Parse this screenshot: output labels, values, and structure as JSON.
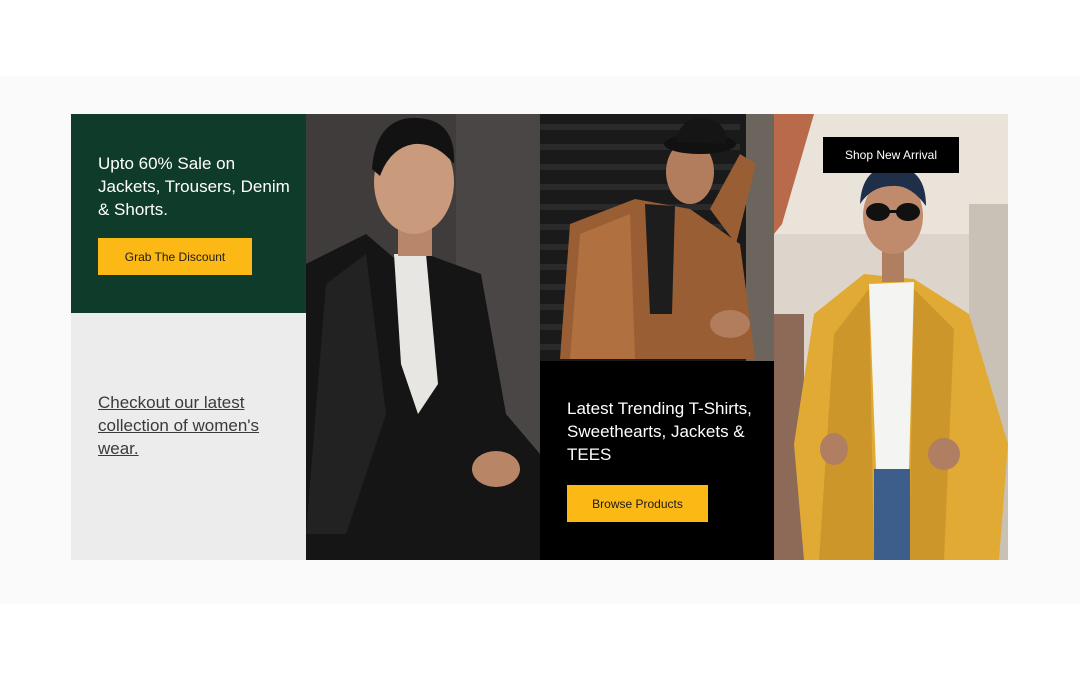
{
  "promo_sale": {
    "headline": "Upto 60% Sale on Jackets, Trousers, Denim & Shorts.",
    "button_label": "Grab The Discount"
  },
  "womens_promo": {
    "link_text": "Checkout our latest collection of women's wear."
  },
  "trending_promo": {
    "headline": "Latest Trending T-Shirts, Sweethearts, Jackets & TEES",
    "button_label": "Browse Products"
  },
  "arrival": {
    "button_label": "Shop New Arrival"
  },
  "colors": {
    "green_panel": "#0f3b2a",
    "accent_yellow": "#fcb814",
    "black_panel": "#000000",
    "gray_panel": "#ececec"
  }
}
